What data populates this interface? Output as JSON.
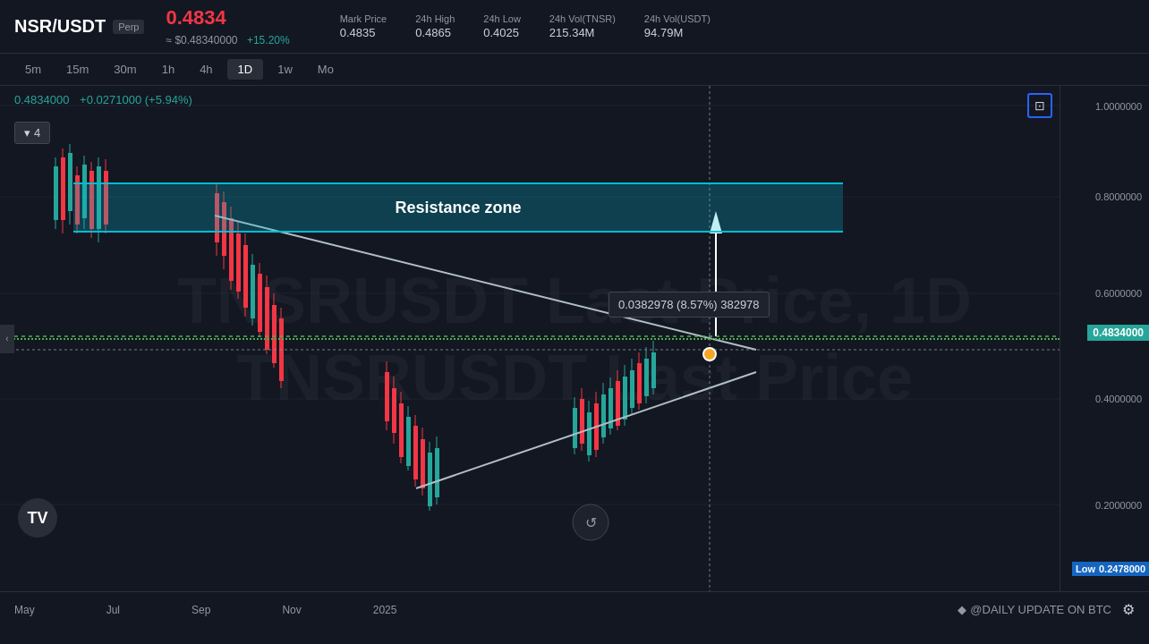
{
  "header": {
    "symbol": "NSR/USDT",
    "perp": "Perp",
    "price": "0.4834",
    "usd_price": "≈ $0.48340000",
    "change": "+15.20%",
    "stats": [
      {
        "label": "Mark Price",
        "value": "0.4835"
      },
      {
        "label": "24h High",
        "value": "0.4865"
      },
      {
        "label": "24h Low",
        "value": "0.4025"
      },
      {
        "label": "24h Vol(TNSR)",
        "value": "215.34M"
      },
      {
        "label": "24h Vol(USDT)",
        "value": "94.79M"
      }
    ]
  },
  "timeframes": [
    "5m",
    "15m",
    "30m",
    "1h",
    "4h",
    "1D",
    "1w",
    "Mo"
  ],
  "active_tf": "1D",
  "chart": {
    "ohlc_price": "0.4834000",
    "ohlc_change": "+0.0271000 (+5.94%)",
    "watermark_line1": "TNSRUSDT Last Price, 1D",
    "watermark_line2": "TNSRUSDT Last Price",
    "resistance_label": "Resistance zone",
    "tooltip_text": "0.0382978 (8.57%) 382978",
    "current_price": "0.4834000",
    "low_label": "Low",
    "low_price": "0.2478000",
    "price_levels": [
      {
        "price": "1.0000000",
        "pct": 4
      },
      {
        "price": "0.8000000",
        "pct": 22
      },
      {
        "price": "0.6000000",
        "pct": 41
      },
      {
        "price": "0.4000000",
        "pct": 62
      },
      {
        "price": "0.2000000",
        "pct": 83
      }
    ]
  },
  "bottom": {
    "dates": [
      "May",
      "Jul",
      "Sep",
      "Nov",
      "2025"
    ],
    "watermark": "@DAILY UPDATE ON BTC"
  },
  "buttons": {
    "collapse": "4",
    "collapse_arrow": "▾"
  }
}
